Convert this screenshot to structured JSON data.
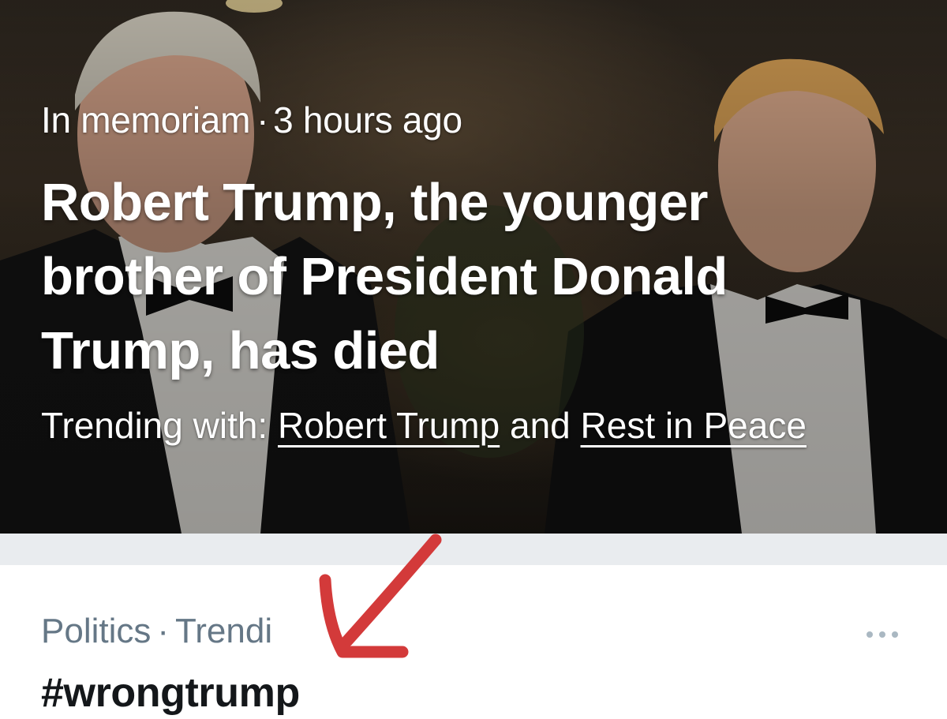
{
  "story": {
    "category": "In memoriam",
    "separator": "·",
    "time": "3 hours ago",
    "headline": "Robert Trump, the younger brother of President Donald Trump, has died",
    "trending_prefix": "Trending with:",
    "trending_links": [
      "Robert Trump",
      "Rest in Peace"
    ],
    "trending_conjunction": "and"
  },
  "trend": {
    "category": "Politics",
    "separator": "·",
    "status": "Trendi",
    "hashtag": "#wrongtrump",
    "more_icon": "more-horizontal-icon"
  },
  "colors": {
    "meta_gray": "#657786",
    "text_dark": "#14171a",
    "divider": "#e9ecef",
    "annotation_red": "#d33a3a"
  }
}
